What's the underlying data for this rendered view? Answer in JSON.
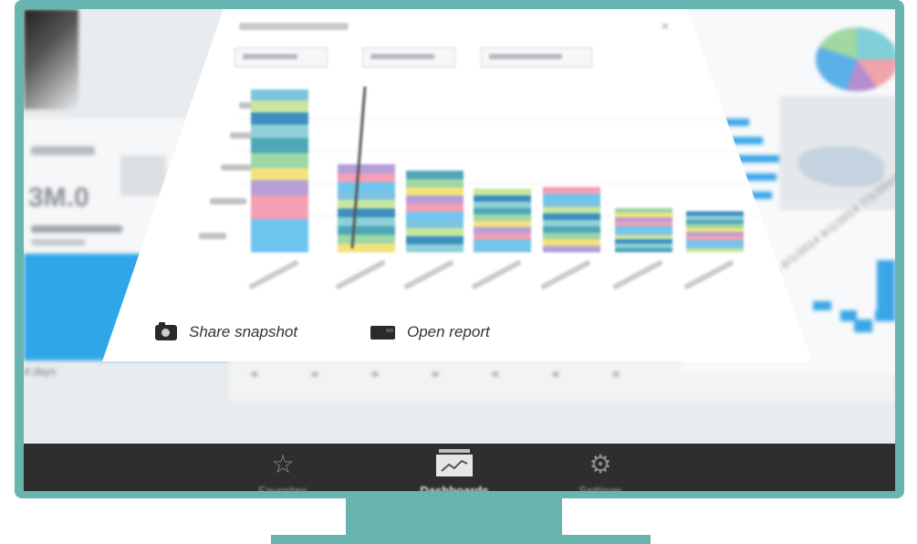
{
  "card": {
    "share_label": "Share snapshot",
    "open_label": "Open report"
  },
  "chart_data": {
    "type": "bar",
    "stacked": true,
    "categories": [
      "",
      "",
      "",
      "",
      "",
      "",
      ""
    ],
    "values": [
      100,
      54,
      50,
      39,
      40,
      27,
      25
    ],
    "segment_colors": [
      "#6ec6f0",
      "#f49fb3",
      "#b69ed8",
      "#f3e27c",
      "#9ed6a4",
      "#4fa7b8",
      "#8fd0d8",
      "#3d8fc0",
      "#c8e6a0",
      "#7dc3e0"
    ],
    "grid": true,
    "legend": "none"
  },
  "tabs": [
    {
      "id": "favorites",
      "label": "Favorites",
      "icon": "star-icon"
    },
    {
      "id": "dashboards",
      "label": "Dashboards",
      "icon": "dashboard-icon"
    },
    {
      "id": "settings",
      "label": "Settings",
      "icon": "gear-icon"
    }
  ],
  "background": {
    "left_kpi": "3M.0",
    "left_footer": "4 days",
    "date_axis": "7/1/2014 7/1/2014 6/1/2014 6/1/2014 7/1/2014"
  },
  "colors": {
    "monitor_frame": "#68b4ae",
    "tab_bar": "#2e2e2e",
    "accent_blue": "#3aa6e8"
  }
}
